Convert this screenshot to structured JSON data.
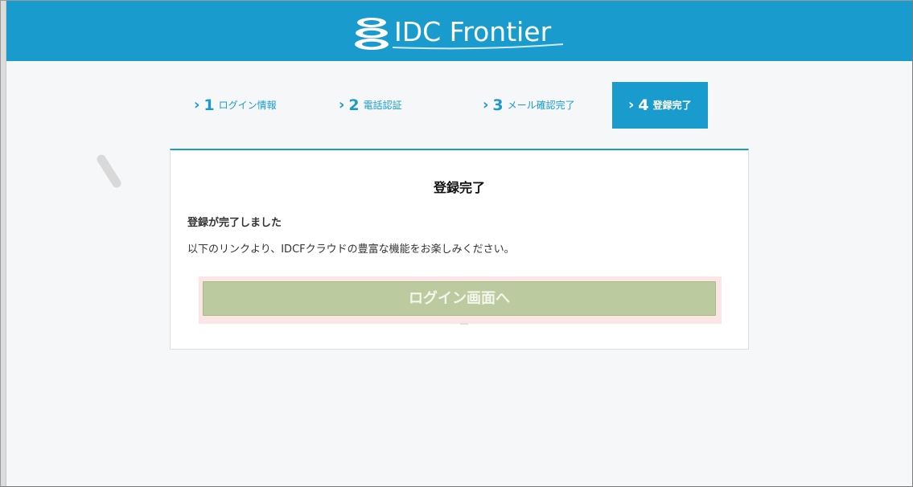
{
  "header": {
    "logo_text": "IDC Frontier",
    "background_color": "#1a9bcd"
  },
  "steps": [
    {
      "chevron": "›",
      "number": "1",
      "label": "ログイン情報",
      "active": false
    },
    {
      "chevron": "›",
      "number": "2",
      "label": "電話認証",
      "active": false
    },
    {
      "chevron": "›",
      "number": "3",
      "label": "メール確認完了",
      "active": false
    },
    {
      "chevron": "›",
      "number": "4",
      "label": "登録完了",
      "active": true
    }
  ],
  "card": {
    "title": "登録完了",
    "message_strong": "登録が完了しました",
    "message_body": "以下のリンクより、IDCFクラウドの豊富な機能をお楽しみください。",
    "login_button_label": "ログイン画面へ"
  },
  "colors": {
    "accent": "#1a9bcd",
    "button": "#bccb9f",
    "button_highlight": "#fbe6e5"
  },
  "icons": {
    "logo": "idcf-disc-stack-icon",
    "step_chevron": "chevron-right-icon"
  }
}
